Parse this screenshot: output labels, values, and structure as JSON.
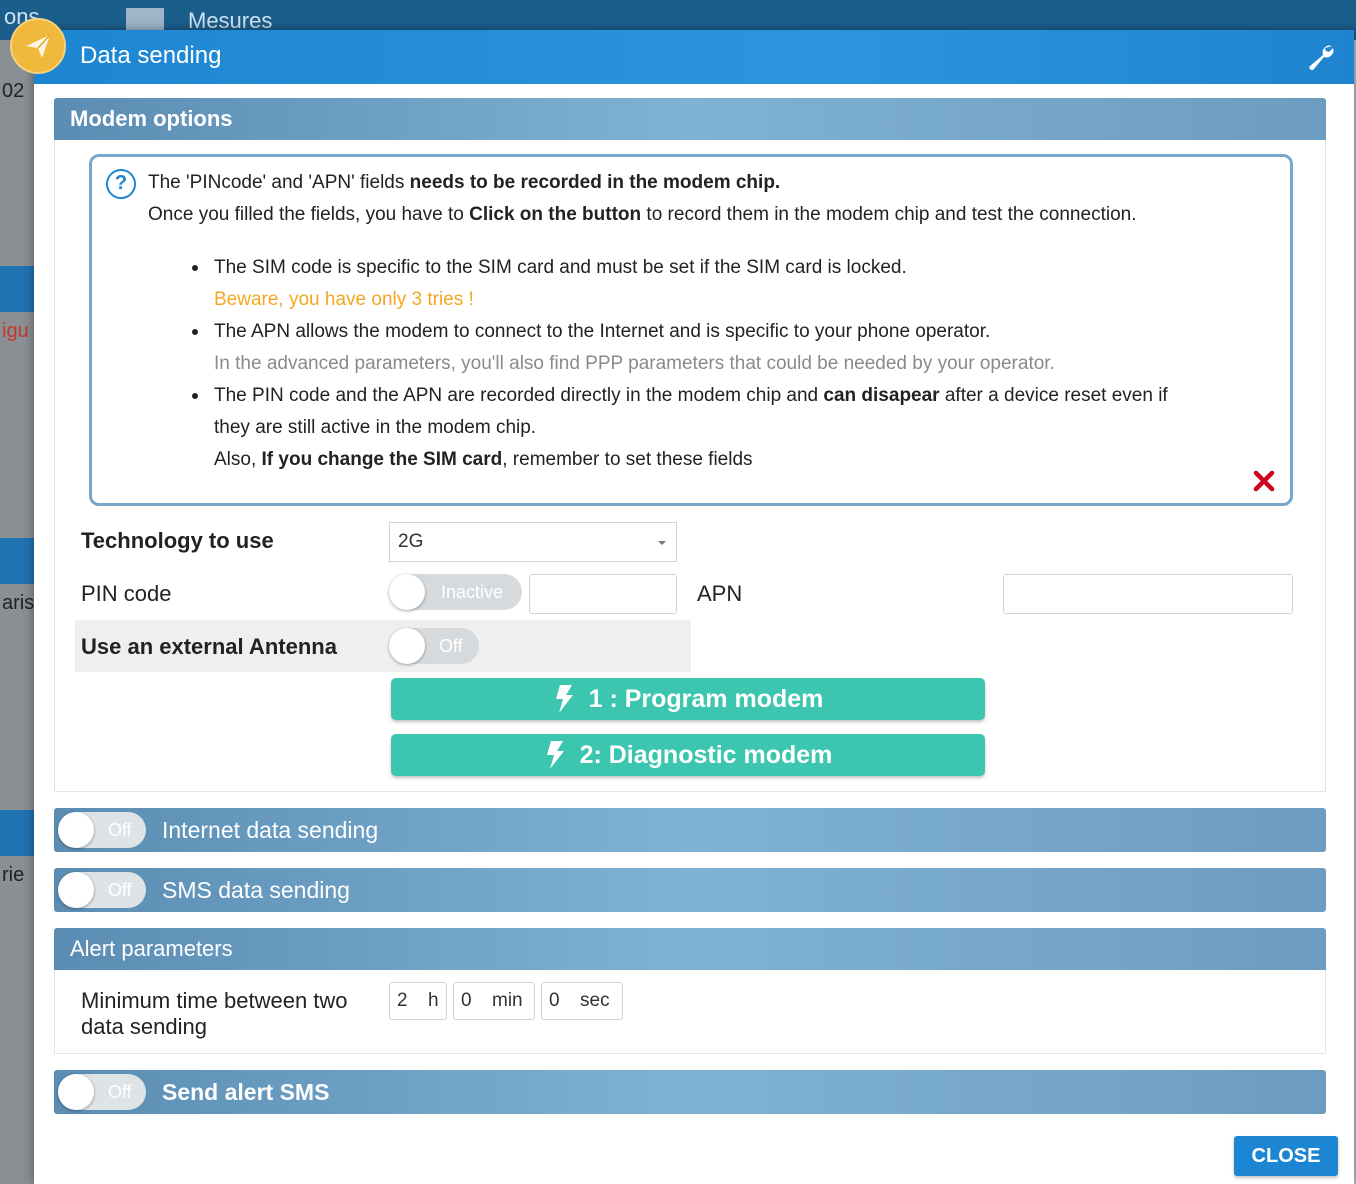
{
  "background": {
    "tab_left": "ons",
    "tab_measures": "Mesures",
    "left_texts": [
      "02",
      "igu",
      "aris",
      "rie"
    ]
  },
  "modal": {
    "title": "Data sending",
    "plane_icon": "paper-plane-icon",
    "settings_icon": "wrench-icon"
  },
  "modem": {
    "section_title": "Modem options",
    "info": {
      "line1_pre": "The 'PINcode' and 'APN' fields ",
      "line1_bold": "needs to be recorded in the modem chip.",
      "line2_pre": "Once you filled the fields, you have to ",
      "line2_bold": "Click on the button",
      "line2_post": " to record them in the modem chip and test the connection.",
      "bullet1": "The SIM code is specific to the SIM card and must be set if the SIM card is locked.",
      "bullet1_warning": "Beware, you have only 3 tries !",
      "bullet2": "The APN allows the modem to connect to the Internet and is specific to your phone operator.",
      "bullet2_note": "In the advanced parameters, you'll also find PPP parameters that could be needed by your operator.",
      "bullet3_pre": "The PIN code and the APN are recorded directly in the modem chip and ",
      "bullet3_bold": "can disapear",
      "bullet3_post": " after a device reset even if",
      "bullet3_cont": "they are still active in the modem chip.",
      "bullet3_also_pre": "Also, ",
      "bullet3_also_bold": "If you change the SIM card",
      "bullet3_also_post": ", remember to set these fields"
    },
    "technology_label": "Technology to use",
    "technology_value": "2G",
    "pin_label": "PIN code",
    "pin_toggle": "Inactive",
    "pin_value": "",
    "apn_label": "APN",
    "apn_value": "",
    "antenna_label": "Use an external Antenna",
    "antenna_toggle": "Off",
    "program_button": "1 : Program modem",
    "diagnostic_button": "2: Diagnostic modem"
  },
  "internet_sending": {
    "toggle": "Off",
    "label": "Internet data sending"
  },
  "sms_sending": {
    "toggle": "Off",
    "label": "SMS data sending"
  },
  "alert": {
    "section_title": "Alert parameters",
    "min_time_label_1": "Minimum time between two",
    "min_time_label_2": "data sending",
    "hours": "2",
    "hours_unit": "h",
    "minutes": "0",
    "minutes_unit": "min",
    "seconds": "0",
    "seconds_unit": "sec"
  },
  "alert_sms": {
    "toggle": "Off",
    "label": "Send alert SMS"
  },
  "close_button": "CLOSE",
  "colors": {
    "header_blue": "#1d86d2",
    "section_bar": "#7fb2d3",
    "action_teal": "#3cc6b0",
    "warning_orange": "#f5a623",
    "close_red": "#d0021b"
  }
}
